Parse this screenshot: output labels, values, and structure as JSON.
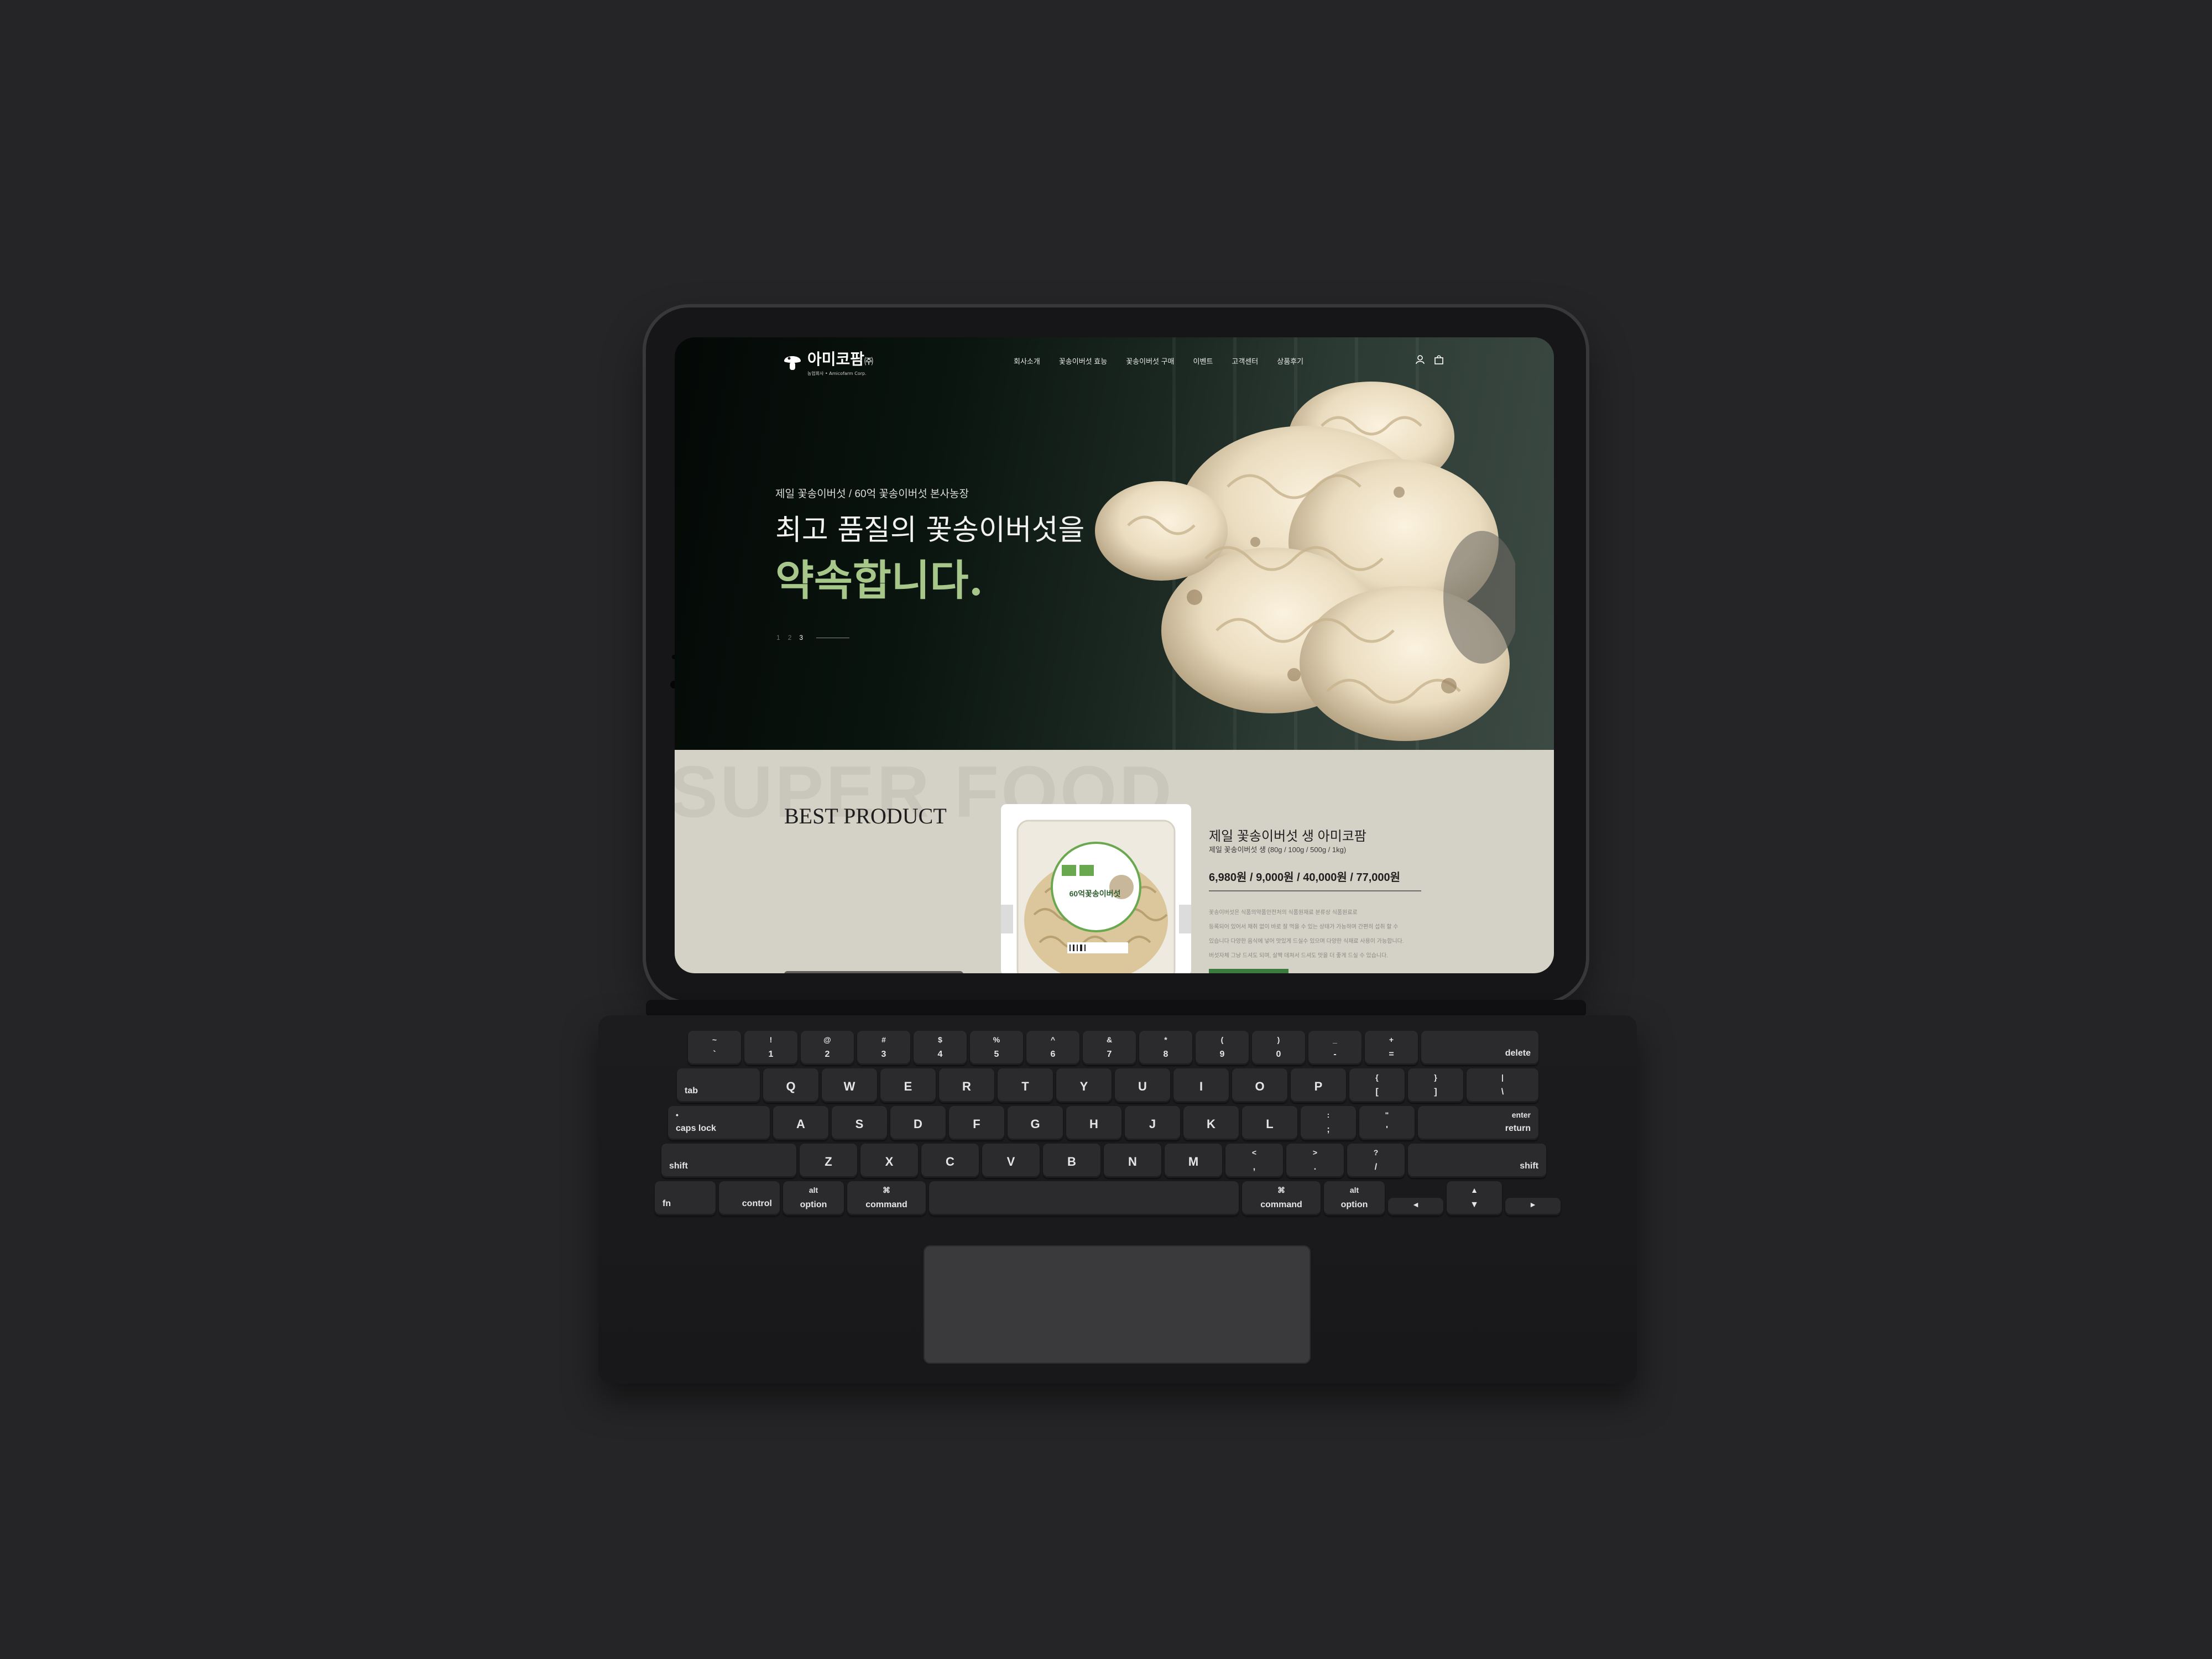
{
  "site": {
    "logo": {
      "name": "아미코팜",
      "suffix": "㈜",
      "tagline": "농업회사 • Amicofarm Corp."
    },
    "nav": [
      "회사소개",
      "꽃송이버섯 효능",
      "꽃송이버섯 구매",
      "이벤트",
      "고객센터",
      "상품후기"
    ],
    "icons": {
      "account": "user-icon",
      "cart": "cart-icon"
    },
    "hero": {
      "subtitle": "제일 꽃송이버섯 / 60억 꽃송이버섯 본사농장",
      "headline_1": "최고 품질의 꽃송이버섯을",
      "headline_2": "약속합니다.",
      "pager": [
        "1",
        "2",
        "3"
      ],
      "pager_active": "3",
      "accent_color": "#a6c789"
    },
    "best": {
      "watermark": "SUPER FOOD",
      "title": "BEST PRODUCT",
      "product": {
        "package_label": "60억꽃송이버섯",
        "name": "제일 꽃송이버섯 생 아미코팜",
        "spec": "제일 꽃송이버섯 생 (80g / 100g / 500g / 1kg)",
        "price": "6,980원 / 9,000원 / 40,000원 / 77,000원",
        "description": [
          "꽃송이버섯은 식품의약품안전처의 식품원재료 분류상 식품원료로",
          "등록되어 있어서 채취 없이 바로 잘 먹을 수 있는 상태가 가능하며 간편히 섭취 할 수",
          "있습니다 다양한 음식에 넣어 맛있게 드실수 있으며 다양한 식재료 사용이 가능합니다.",
          "버섯자체 그냥 드셔도 되며, 살짝 데쳐서 드셔도 맛을 더 좋게 드실 수 있습니다."
        ],
        "button_color": "#3d7a3e"
      }
    }
  },
  "keyboard": {
    "row1": [
      {
        "top": "~",
        "bot": "`"
      },
      {
        "top": "!",
        "bot": "1"
      },
      {
        "top": "@",
        "bot": "2"
      },
      {
        "top": "#",
        "bot": "3"
      },
      {
        "top": "$",
        "bot": "4"
      },
      {
        "top": "%",
        "bot": "5"
      },
      {
        "top": "^",
        "bot": "6"
      },
      {
        "top": "&",
        "bot": "7"
      },
      {
        "top": "*",
        "bot": "8"
      },
      {
        "top": "(",
        "bot": "9"
      },
      {
        "top": ")",
        "bot": "0"
      },
      {
        "top": "_",
        "bot": "-"
      },
      {
        "top": "+",
        "bot": "="
      },
      {
        "label": "delete"
      }
    ],
    "row2": [
      {
        "label": "tab"
      },
      {
        "mid": "Q"
      },
      {
        "mid": "W"
      },
      {
        "mid": "E"
      },
      {
        "mid": "R"
      },
      {
        "mid": "T"
      },
      {
        "mid": "Y"
      },
      {
        "mid": "U"
      },
      {
        "mid": "I"
      },
      {
        "mid": "O"
      },
      {
        "mid": "P"
      },
      {
        "top": "{",
        "bot": "["
      },
      {
        "top": "}",
        "bot": "]"
      },
      {
        "top": "|",
        "bot": "\\"
      }
    ],
    "row3": [
      {
        "top": "•",
        "label": "caps lock"
      },
      {
        "mid": "A"
      },
      {
        "mid": "S"
      },
      {
        "mid": "D"
      },
      {
        "mid": "F"
      },
      {
        "mid": "G"
      },
      {
        "mid": "H"
      },
      {
        "mid": "J"
      },
      {
        "mid": "K"
      },
      {
        "mid": "L"
      },
      {
        "top": ":",
        "bot": ";"
      },
      {
        "top": "\"",
        "bot": "'"
      },
      {
        "top": "enter",
        "label": "return"
      }
    ],
    "row4": [
      {
        "label": "shift"
      },
      {
        "mid": "Z"
      },
      {
        "mid": "X"
      },
      {
        "mid": "C"
      },
      {
        "mid": "V"
      },
      {
        "mid": "B"
      },
      {
        "mid": "N"
      },
      {
        "mid": "M"
      },
      {
        "top": "<",
        "bot": ","
      },
      {
        "top": ">",
        "bot": "."
      },
      {
        "top": "?",
        "bot": "/"
      },
      {
        "label": "shift"
      }
    ],
    "row5": [
      {
        "label": "fn"
      },
      {
        "label": "control"
      },
      {
        "top": "alt",
        "bot": "option"
      },
      {
        "top": "⌘",
        "bot": "command"
      },
      {
        "label": ""
      },
      {
        "top": "⌘",
        "bot": "command"
      },
      {
        "top": "alt",
        "bot": "option"
      },
      {
        "mid": "◄"
      },
      {
        "top": "▲",
        "bot": "▼"
      },
      {
        "mid": "►"
      }
    ]
  }
}
